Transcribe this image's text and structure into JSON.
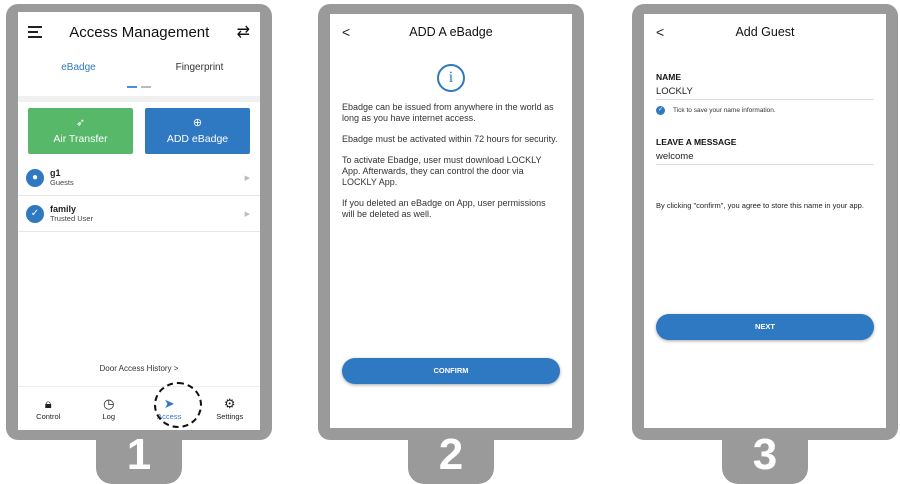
{
  "steps": [
    "1",
    "2",
    "3"
  ],
  "screen1": {
    "title": "Access Management",
    "tabs": [
      "eBadge",
      "Fingerprint"
    ],
    "air_transfer": "Air Transfer",
    "add_ebadge": "ADD eBadge",
    "users": [
      {
        "name": "g1",
        "role": "Guests"
      },
      {
        "name": "family",
        "role": "Trusted User"
      }
    ],
    "history_link": "Door Access History >",
    "nav": [
      "Control",
      "Log",
      "Access",
      "Settings"
    ]
  },
  "screen2": {
    "back": "<",
    "title": "ADD A eBadge",
    "paragraphs": [
      "Ebadge can be issued from anywhere in the world as long as you have internet access.",
      "Ebadge must be activated within 72 hours for security.",
      "To activate Ebadge, user must download LOCKLY App. Afterwards, they can control the door via LOCKLY App.",
      "If you deleted an eBadge on App, user permissions will be deleted as well."
    ],
    "confirm": "CONFIRM"
  },
  "screen3": {
    "back": "<",
    "title": "Add Guest",
    "name_label": "NAME",
    "name_value": "LOCKLY",
    "tick_text": "Tick to save your name information.",
    "message_label": "LEAVE A MESSAGE",
    "message_value": "welcome",
    "agreement": "By clicking \"confirm\", you agree to store this name in your app.",
    "next": "NEXT"
  },
  "colors": {
    "accent": "#2f78c2",
    "green": "#58b86a",
    "frame": "#9a9a9a"
  },
  "icons": [
    "menu-icon",
    "swap-icon",
    "paper-plane-icon",
    "plus-circle-icon",
    "user-icon",
    "shield-check-icon",
    "lock-icon",
    "clock-icon",
    "send-icon",
    "gear-icon",
    "info-icon",
    "check-icon",
    "back-icon"
  ]
}
